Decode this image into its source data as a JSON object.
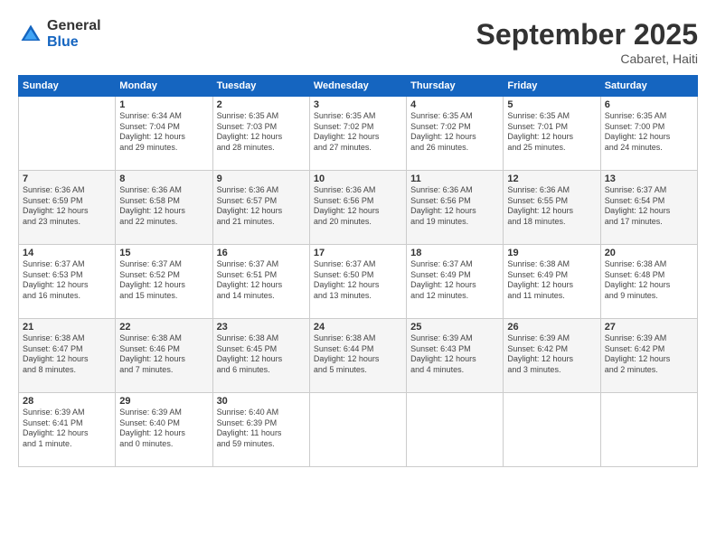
{
  "logo": {
    "general": "General",
    "blue": "Blue"
  },
  "title": "September 2025",
  "location": "Cabaret, Haiti",
  "days_header": [
    "Sunday",
    "Monday",
    "Tuesday",
    "Wednesday",
    "Thursday",
    "Friday",
    "Saturday"
  ],
  "weeks": [
    [
      {
        "day": "",
        "info": ""
      },
      {
        "day": "1",
        "info": "Sunrise: 6:34 AM\nSunset: 7:04 PM\nDaylight: 12 hours\nand 29 minutes."
      },
      {
        "day": "2",
        "info": "Sunrise: 6:35 AM\nSunset: 7:03 PM\nDaylight: 12 hours\nand 28 minutes."
      },
      {
        "day": "3",
        "info": "Sunrise: 6:35 AM\nSunset: 7:02 PM\nDaylight: 12 hours\nand 27 minutes."
      },
      {
        "day": "4",
        "info": "Sunrise: 6:35 AM\nSunset: 7:02 PM\nDaylight: 12 hours\nand 26 minutes."
      },
      {
        "day": "5",
        "info": "Sunrise: 6:35 AM\nSunset: 7:01 PM\nDaylight: 12 hours\nand 25 minutes."
      },
      {
        "day": "6",
        "info": "Sunrise: 6:35 AM\nSunset: 7:00 PM\nDaylight: 12 hours\nand 24 minutes."
      }
    ],
    [
      {
        "day": "7",
        "info": "Sunrise: 6:36 AM\nSunset: 6:59 PM\nDaylight: 12 hours\nand 23 minutes."
      },
      {
        "day": "8",
        "info": "Sunrise: 6:36 AM\nSunset: 6:58 PM\nDaylight: 12 hours\nand 22 minutes."
      },
      {
        "day": "9",
        "info": "Sunrise: 6:36 AM\nSunset: 6:57 PM\nDaylight: 12 hours\nand 21 minutes."
      },
      {
        "day": "10",
        "info": "Sunrise: 6:36 AM\nSunset: 6:56 PM\nDaylight: 12 hours\nand 20 minutes."
      },
      {
        "day": "11",
        "info": "Sunrise: 6:36 AM\nSunset: 6:56 PM\nDaylight: 12 hours\nand 19 minutes."
      },
      {
        "day": "12",
        "info": "Sunrise: 6:36 AM\nSunset: 6:55 PM\nDaylight: 12 hours\nand 18 minutes."
      },
      {
        "day": "13",
        "info": "Sunrise: 6:37 AM\nSunset: 6:54 PM\nDaylight: 12 hours\nand 17 minutes."
      }
    ],
    [
      {
        "day": "14",
        "info": "Sunrise: 6:37 AM\nSunset: 6:53 PM\nDaylight: 12 hours\nand 16 minutes."
      },
      {
        "day": "15",
        "info": "Sunrise: 6:37 AM\nSunset: 6:52 PM\nDaylight: 12 hours\nand 15 minutes."
      },
      {
        "day": "16",
        "info": "Sunrise: 6:37 AM\nSunset: 6:51 PM\nDaylight: 12 hours\nand 14 minutes."
      },
      {
        "day": "17",
        "info": "Sunrise: 6:37 AM\nSunset: 6:50 PM\nDaylight: 12 hours\nand 13 minutes."
      },
      {
        "day": "18",
        "info": "Sunrise: 6:37 AM\nSunset: 6:49 PM\nDaylight: 12 hours\nand 12 minutes."
      },
      {
        "day": "19",
        "info": "Sunrise: 6:38 AM\nSunset: 6:49 PM\nDaylight: 12 hours\nand 11 minutes."
      },
      {
        "day": "20",
        "info": "Sunrise: 6:38 AM\nSunset: 6:48 PM\nDaylight: 12 hours\nand 9 minutes."
      }
    ],
    [
      {
        "day": "21",
        "info": "Sunrise: 6:38 AM\nSunset: 6:47 PM\nDaylight: 12 hours\nand 8 minutes."
      },
      {
        "day": "22",
        "info": "Sunrise: 6:38 AM\nSunset: 6:46 PM\nDaylight: 12 hours\nand 7 minutes."
      },
      {
        "day": "23",
        "info": "Sunrise: 6:38 AM\nSunset: 6:45 PM\nDaylight: 12 hours\nand 6 minutes."
      },
      {
        "day": "24",
        "info": "Sunrise: 6:38 AM\nSunset: 6:44 PM\nDaylight: 12 hours\nand 5 minutes."
      },
      {
        "day": "25",
        "info": "Sunrise: 6:39 AM\nSunset: 6:43 PM\nDaylight: 12 hours\nand 4 minutes."
      },
      {
        "day": "26",
        "info": "Sunrise: 6:39 AM\nSunset: 6:42 PM\nDaylight: 12 hours\nand 3 minutes."
      },
      {
        "day": "27",
        "info": "Sunrise: 6:39 AM\nSunset: 6:42 PM\nDaylight: 12 hours\nand 2 minutes."
      }
    ],
    [
      {
        "day": "28",
        "info": "Sunrise: 6:39 AM\nSunset: 6:41 PM\nDaylight: 12 hours\nand 1 minute."
      },
      {
        "day": "29",
        "info": "Sunrise: 6:39 AM\nSunset: 6:40 PM\nDaylight: 12 hours\nand 0 minutes."
      },
      {
        "day": "30",
        "info": "Sunrise: 6:40 AM\nSunset: 6:39 PM\nDaylight: 11 hours\nand 59 minutes."
      },
      {
        "day": "",
        "info": ""
      },
      {
        "day": "",
        "info": ""
      },
      {
        "day": "",
        "info": ""
      },
      {
        "day": "",
        "info": ""
      }
    ]
  ]
}
